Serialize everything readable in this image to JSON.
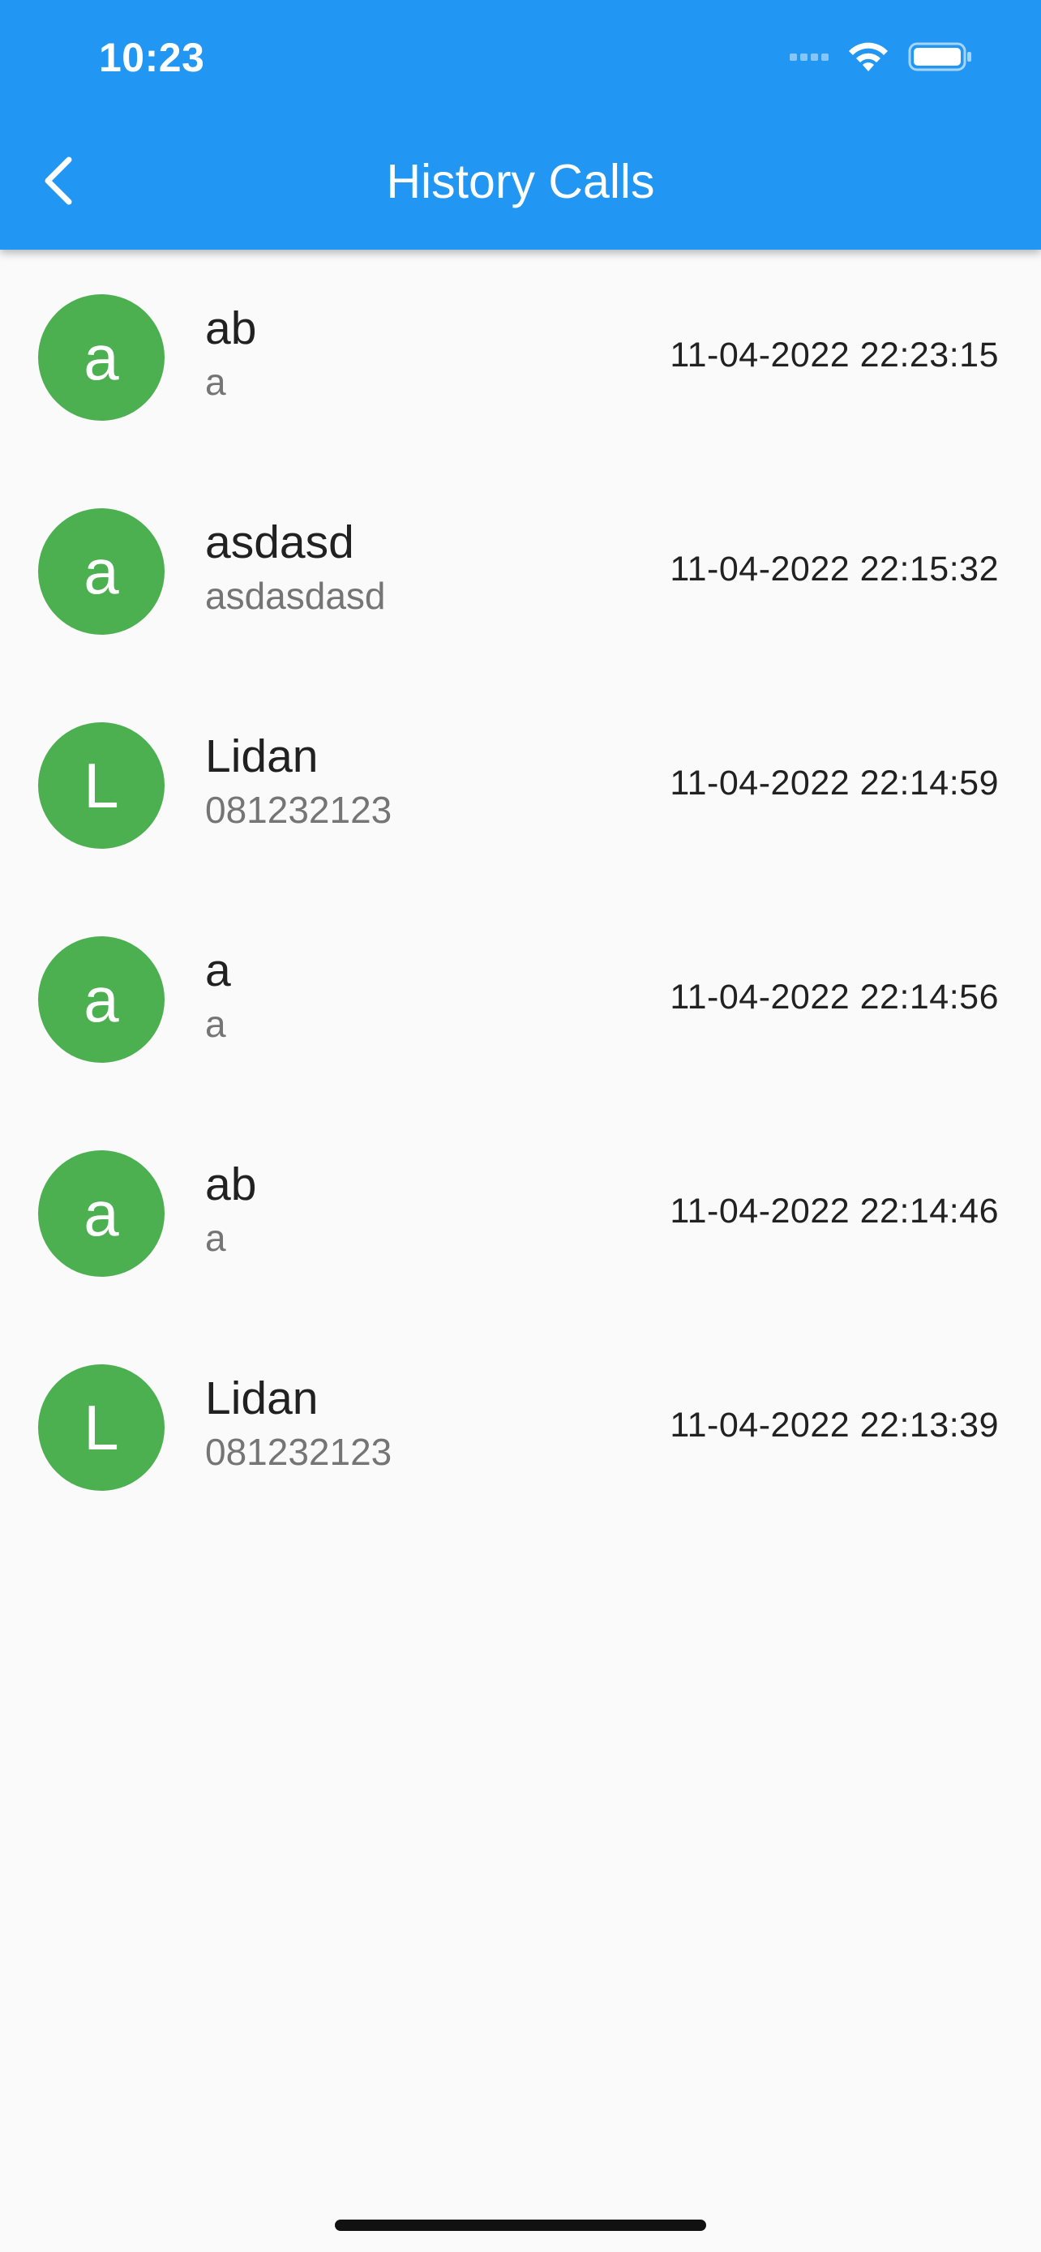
{
  "status_bar": {
    "time": "10:23"
  },
  "header": {
    "title": "History Calls",
    "back_icon": "chevron-left-icon",
    "background_color": "#2196f3"
  },
  "avatar_color": "#4caf50",
  "calls": [
    {
      "initial": "a",
      "name": "ab",
      "subtitle": "a",
      "datetime": "11-04-2022 22:23:15"
    },
    {
      "initial": "a",
      "name": "asdasd",
      "subtitle": "asdasdasd",
      "datetime": "11-04-2022 22:15:32"
    },
    {
      "initial": "L",
      "name": "Lidan",
      "subtitle": "081232123",
      "datetime": "11-04-2022 22:14:59"
    },
    {
      "initial": "a",
      "name": "a",
      "subtitle": "a",
      "datetime": "11-04-2022 22:14:56"
    },
    {
      "initial": "a",
      "name": "ab",
      "subtitle": "a",
      "datetime": "11-04-2022 22:14:46"
    },
    {
      "initial": "L",
      "name": "Lidan",
      "subtitle": "081232123",
      "datetime": "11-04-2022 22:13:39"
    }
  ]
}
